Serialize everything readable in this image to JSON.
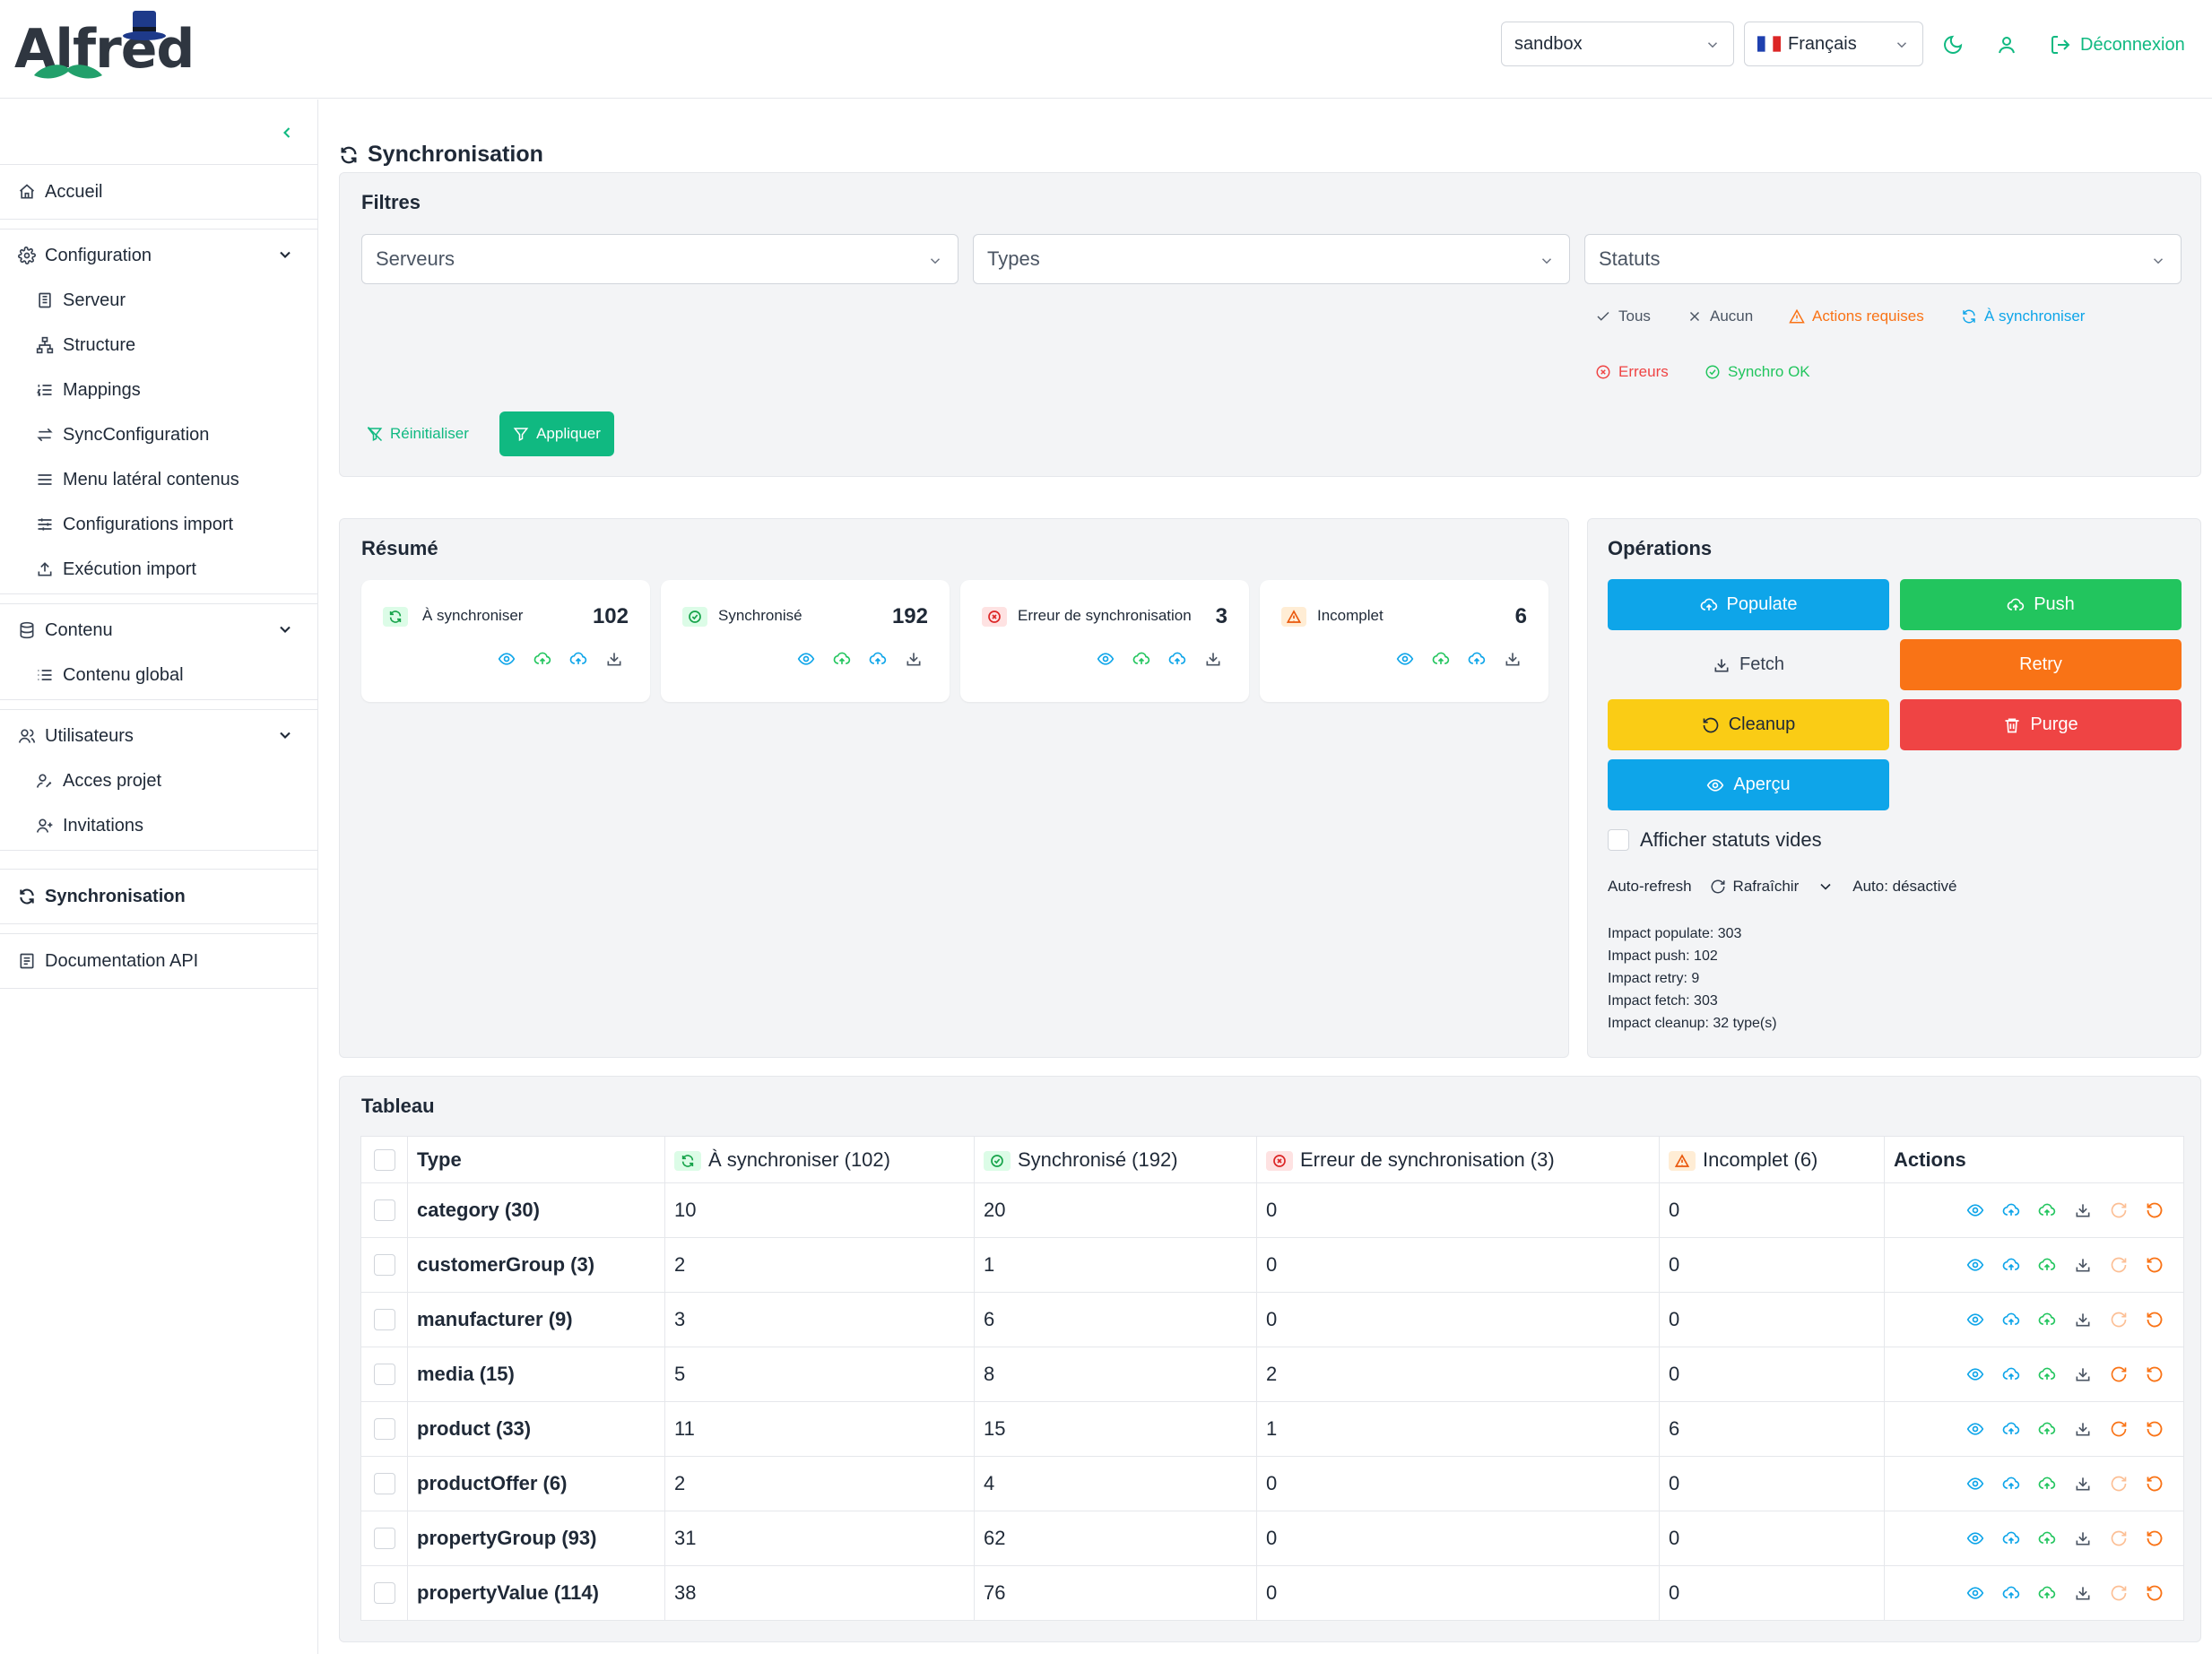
{
  "header": {
    "logo_text": "Alfred",
    "environment_select": "sandbox",
    "language_select": "Français",
    "logout_label": "Déconnexion"
  },
  "sidebar": {
    "home": "Accueil",
    "configuration": {
      "label": "Configuration",
      "items": [
        "Serveur",
        "Structure",
        "Mappings",
        "SyncConfiguration",
        "Menu latéral contenus",
        "Configurations import",
        "Exécution import"
      ]
    },
    "content": {
      "label": "Contenu",
      "items": [
        "Contenu global"
      ]
    },
    "users": {
      "label": "Utilisateurs",
      "items": [
        "Acces projet",
        "Invitations"
      ]
    },
    "sync": "Synchronisation",
    "api_docs": "Documentation API"
  },
  "page": {
    "title": "Synchronisation"
  },
  "filters": {
    "title": "Filtres",
    "servers_placeholder": "Serveurs",
    "types_placeholder": "Types",
    "statuses_placeholder": "Statuts",
    "quick": {
      "all": "Tous",
      "none": "Aucun",
      "actions_required": "Actions requises",
      "to_sync": "À synchroniser",
      "errors": "Erreurs",
      "sync_ok": "Synchro OK"
    },
    "reset_label": "Réinitialiser",
    "apply_label": "Appliquer"
  },
  "summary": {
    "title": "Résumé",
    "cards": [
      {
        "label": "À synchroniser",
        "value": "102"
      },
      {
        "label": "Synchronisé",
        "value": "192"
      },
      {
        "label": "Erreur de synchronisation",
        "value": "3"
      },
      {
        "label": "Incomplet",
        "value": "6"
      }
    ]
  },
  "operations": {
    "title": "Opérations",
    "populate": "Populate",
    "push": "Push",
    "fetch": "Fetch",
    "retry": "Retry",
    "cleanup": "Cleanup",
    "purge": "Purge",
    "preview": "Aperçu",
    "show_empty_label": "Afficher statuts vides",
    "auto_refresh_label": "Auto-refresh",
    "refresh_label": "Rafraîchir",
    "auto_status": "Auto: désactivé",
    "impacts": [
      "Impact populate: 303",
      "Impact push: 102",
      "Impact retry: 9",
      "Impact fetch: 303",
      "Impact cleanup: 32 type(s)"
    ],
    "colors": {
      "blue": "#0ea5e9",
      "green": "#22c55e",
      "orange": "#f97316",
      "yellow": "#facc15",
      "red": "#ef4444"
    }
  },
  "table": {
    "title": "Tableau",
    "headers": {
      "type": "Type",
      "to_sync": "À synchroniser (102)",
      "synced": "Synchronisé (192)",
      "error": "Erreur de synchronisation (3)",
      "incomplete": "Incomplet (6)",
      "actions": "Actions"
    },
    "rows": [
      {
        "type": "category (30)",
        "to_sync": "10",
        "synced": "20",
        "error": "0",
        "incomplete": "0"
      },
      {
        "type": "customerGroup (3)",
        "to_sync": "2",
        "synced": "1",
        "error": "0",
        "incomplete": "0"
      },
      {
        "type": "manufacturer (9)",
        "to_sync": "3",
        "synced": "6",
        "error": "0",
        "incomplete": "0"
      },
      {
        "type": "media (15)",
        "to_sync": "5",
        "synced": "8",
        "error": "2",
        "incomplete": "0"
      },
      {
        "type": "product (33)",
        "to_sync": "11",
        "synced": "15",
        "error": "1",
        "incomplete": "6"
      },
      {
        "type": "productOffer (6)",
        "to_sync": "2",
        "synced": "4",
        "error": "0",
        "incomplete": "0"
      },
      {
        "type": "propertyGroup (93)",
        "to_sync": "31",
        "synced": "62",
        "error": "0",
        "incomplete": "0"
      },
      {
        "type": "propertyValue (114)",
        "to_sync": "38",
        "synced": "76",
        "error": "0",
        "incomplete": "0"
      }
    ]
  }
}
